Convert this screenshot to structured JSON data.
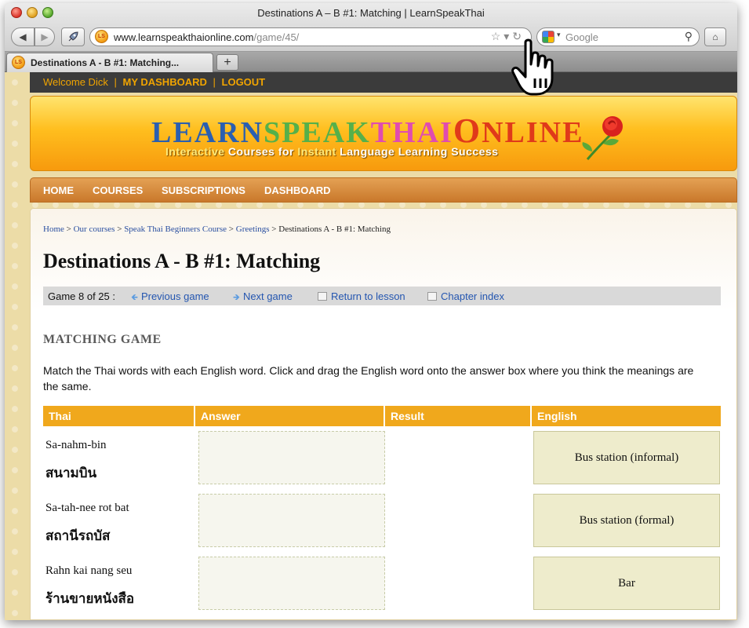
{
  "browser": {
    "window_title": "Destinations A – B #1: Matching | LearnSpeakThai",
    "url_domain": "www.learnspeakthaionline.com",
    "url_path": "/game/45/",
    "search_placeholder": "Google",
    "tab_title": "Destinations A - B #1: Matching...",
    "favicon_text": "LS",
    "new_tab_label": "+",
    "back_glyph": "◀",
    "forward_glyph": "▶",
    "home_glyph": "⌂",
    "url_icons": "☆▾↻",
    "search_caret": "▾",
    "search_mag": "⚲"
  },
  "userbar": {
    "welcome": "Welcome Dick",
    "sep": "|",
    "dashboard": "MY DASHBOARD",
    "logout": "LOGOUT"
  },
  "banner": {
    "logo_learn": "LEARN",
    "logo_speak": "SPEAK",
    "logo_thai": "THAI",
    "logo_o": "O",
    "logo_nline": "NLINE",
    "tagline_1": "Interactive",
    "tagline_2": " Courses for ",
    "tagline_3": "Instant",
    "tagline_4": " Language Learning Success"
  },
  "nav": {
    "home": "HOME",
    "courses": "COURSES",
    "subscriptions": "SUBSCRIPTIONS",
    "dashboard": "DASHBOARD"
  },
  "breadcrumb": {
    "home": "Home",
    "courses": "Our courses",
    "course": "Speak Thai Beginners Course",
    "chapter": "Greetings",
    "current": "Destinations A - B #1: Matching",
    "sep": " > "
  },
  "page_title": "Destinations A - B #1: Matching",
  "gamebar": {
    "count": "Game 8 of 25 :",
    "prev": "Previous game",
    "next": "Next game",
    "lesson": "Return to lesson",
    "chapter": "Chapter index",
    "prev_icon": "🡸",
    "next_icon": "🡺"
  },
  "section_title": "MATCHING GAME",
  "instructions": "Match the Thai words with each English word. Click and drag the English word onto the answer box where you think the meanings are the same.",
  "table": {
    "headers": [
      "Thai",
      "Answer",
      "Result",
      "English"
    ],
    "rows": [
      {
        "translit": "Sa-nahm-bin",
        "thai": "สนามบิน",
        "english": "Bus station (informal)"
      },
      {
        "translit": "Sa-tah-nee rot bat",
        "thai": "สถานีรถบัส",
        "english": "Bus station (formal)"
      },
      {
        "translit": "Rahn kai nang seu",
        "thai": "ร้านขายหนังสือ",
        "english": "Bar"
      }
    ]
  },
  "colors": {
    "header_orange": "#f0a81c",
    "link_blue": "#2456b0",
    "userbar_text": "#f0a400",
    "nav_bg": "#d98b3a"
  }
}
